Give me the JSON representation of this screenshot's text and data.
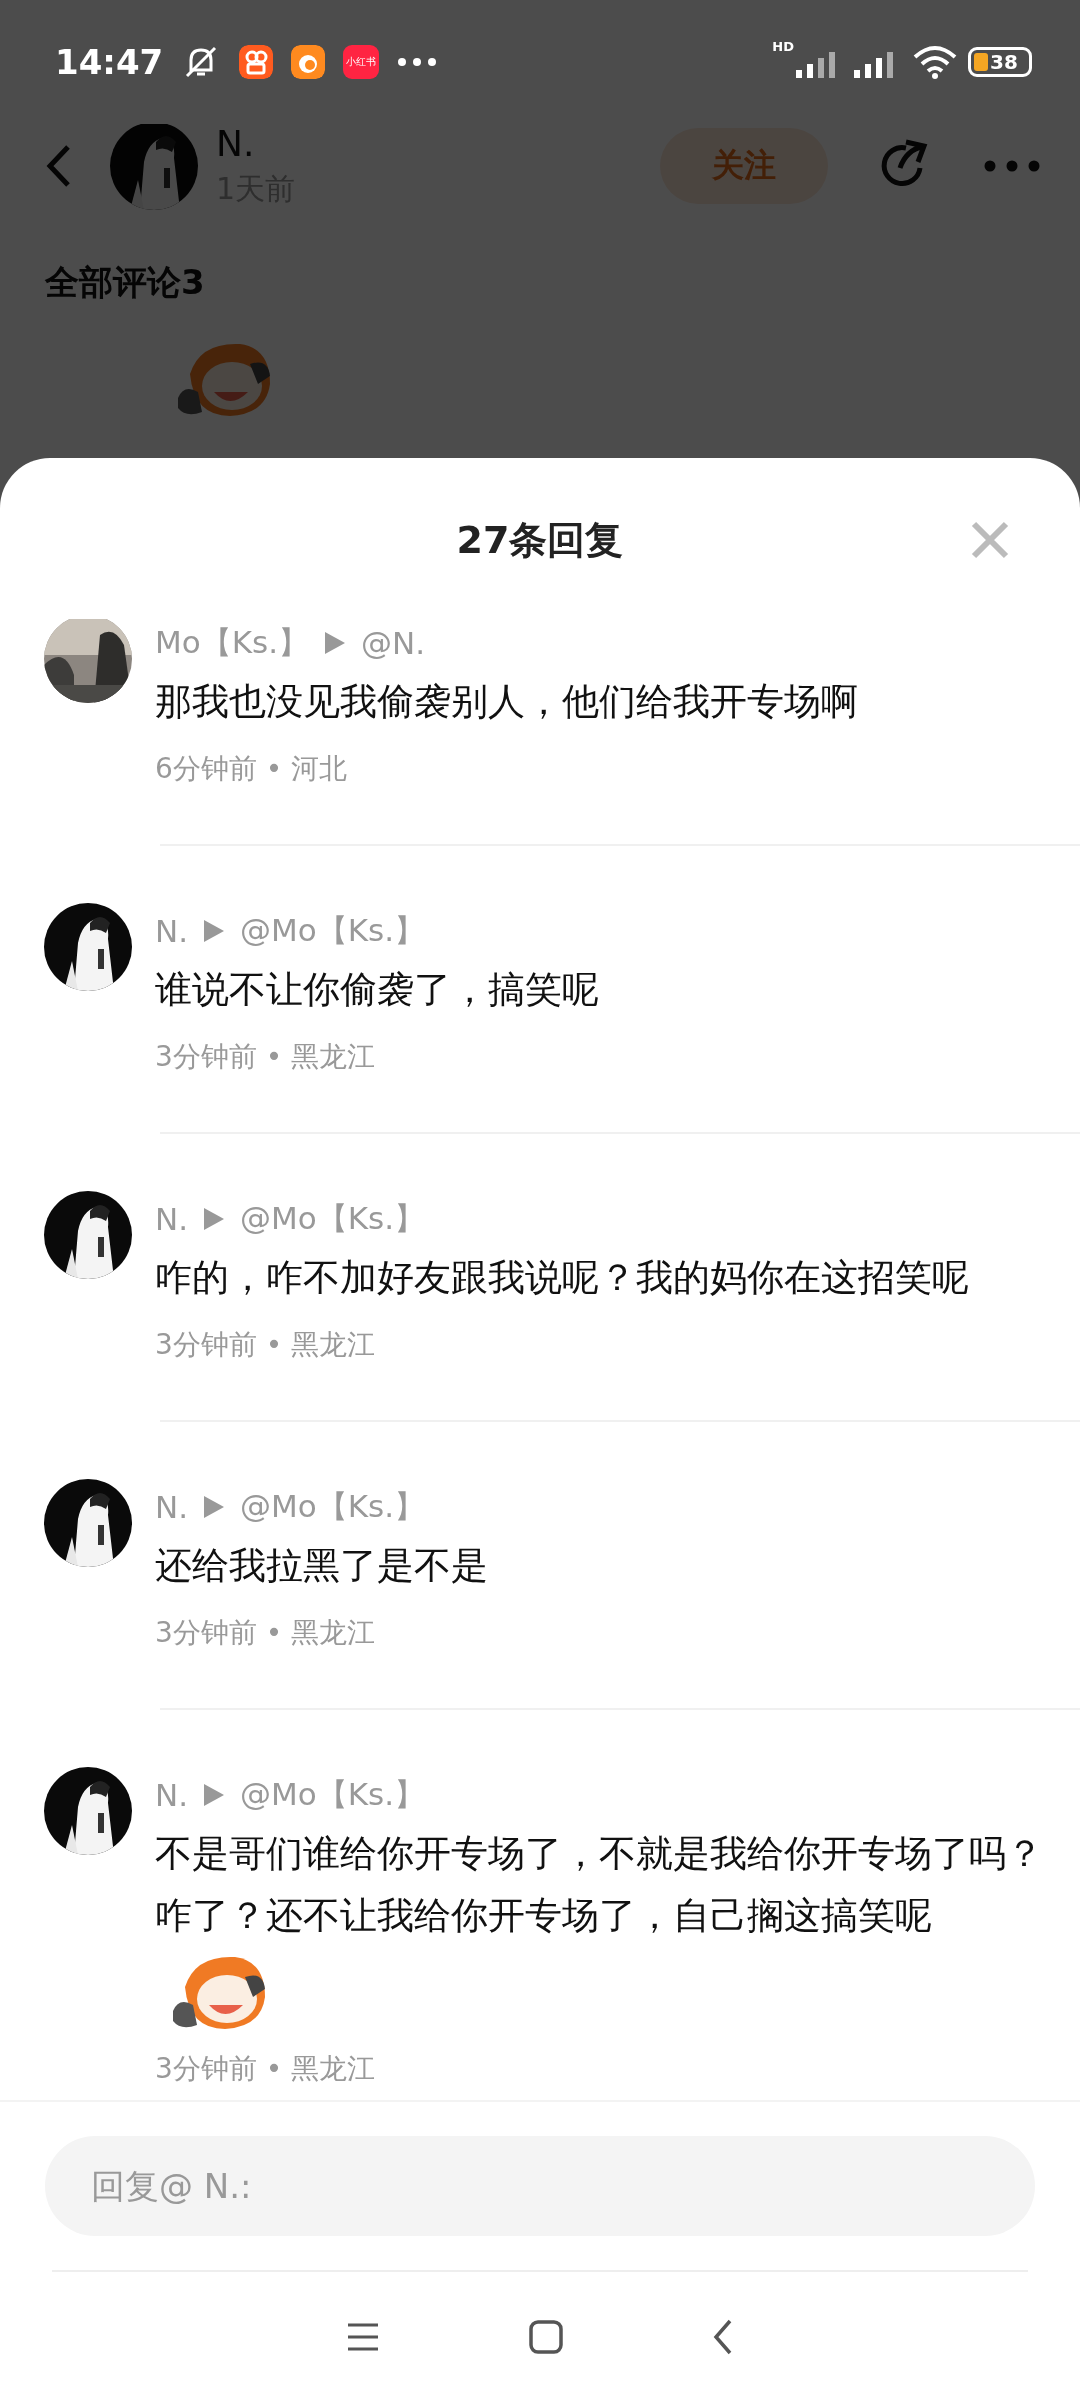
{
  "status_bar": {
    "time": "14:47",
    "app_badge": "小红书",
    "network": "HD",
    "battery": "38"
  },
  "post": {
    "author": "N.",
    "time": "1天前",
    "follow_button": "关注",
    "comments_heading": "全部评论3"
  },
  "sheet": {
    "title": "27条回复",
    "replies": [
      {
        "author": "Mo【Ks.】",
        "target": "@N.",
        "text": "那我也没见我偷袭别人，他们给我开专场啊",
        "meta": "6分钟前 • 河北",
        "sticker": false
      },
      {
        "author": "N.",
        "target": "@Mo【Ks.】",
        "text": "谁说不让你偷袭了，搞笑呢",
        "meta": "3分钟前 • 黑龙江",
        "sticker": false
      },
      {
        "author": "N.",
        "target": "@Mo【Ks.】",
        "text": "咋的，咋不加好友跟我说呢？我的妈你在这招笑呢",
        "meta": "3分钟前 • 黑龙江",
        "sticker": false
      },
      {
        "author": "N.",
        "target": "@Mo【Ks.】",
        "text": "还给我拉黑了是不是",
        "meta": "3分钟前 • 黑龙江",
        "sticker": false
      },
      {
        "author": "N.",
        "target": "@Mo【Ks.】",
        "text": "不是哥们谁给你开专场了，不就是我给你开专场了吗？咋了？还不让我给你开专场了，自己搁这搞笑呢",
        "meta": "3分钟前 • 黑龙江",
        "sticker": true
      }
    ],
    "reply_field": {
      "placeholder": "回复@ N.:"
    }
  }
}
